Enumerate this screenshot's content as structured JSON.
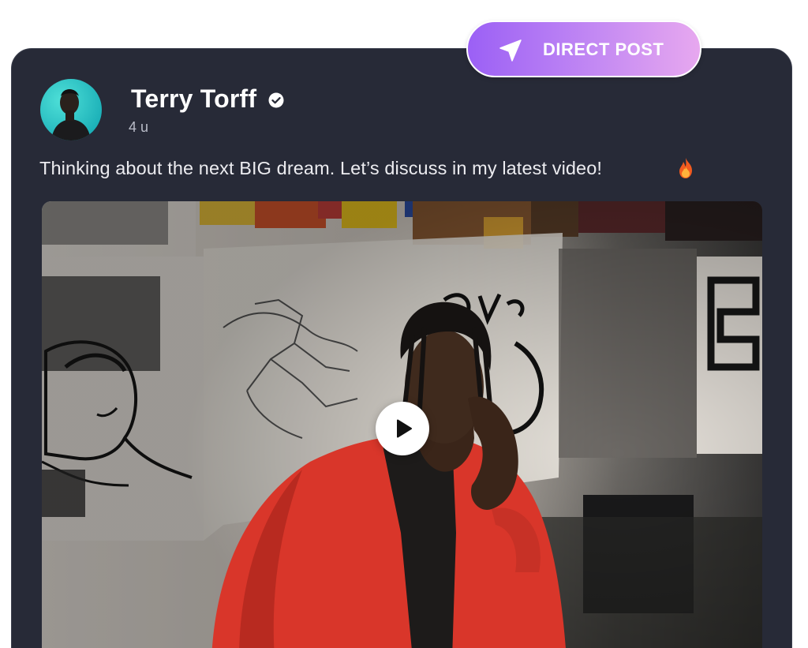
{
  "badge": {
    "label": "DIRECT POST",
    "icon": "send-icon"
  },
  "post": {
    "author": {
      "name": "Terry Torff",
      "verified_icon": "verified-check-icon",
      "avatar": "avatar"
    },
    "time": "4 u",
    "text": "Thinking about the next BIG dream. Let’s discuss in my latest video!",
    "emoji_icon": "fire-icon",
    "media": {
      "type": "video",
      "play_icon": "play-icon"
    }
  },
  "colors": {
    "card_background": "#272a37",
    "badge_gradient_start": "#9b60f5",
    "badge_gradient_end": "#e7a8ef",
    "text_primary": "#ffffff",
    "text_secondary": "#b9bcc8"
  }
}
